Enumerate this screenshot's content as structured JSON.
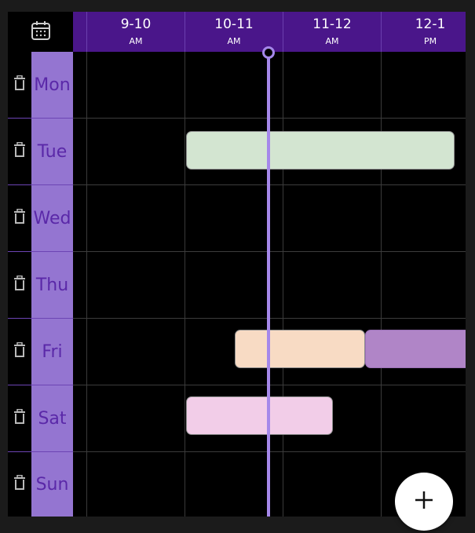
{
  "header": {
    "calendar_icon": "calendar-icon",
    "slots": [
      {
        "label": "9-10",
        "period": "AM"
      },
      {
        "label": "10-11",
        "period": "AM"
      },
      {
        "label": "11-12",
        "period": "AM"
      },
      {
        "label": "12-1",
        "period": "PM"
      }
    ]
  },
  "days": [
    {
      "name": "Mon",
      "delete_icon": "trash-icon"
    },
    {
      "name": "Tue",
      "delete_icon": "trash-icon"
    },
    {
      "name": "Wed",
      "delete_icon": "trash-icon"
    },
    {
      "name": "Thu",
      "delete_icon": "trash-icon"
    },
    {
      "name": "Fri",
      "delete_icon": "trash-icon"
    },
    {
      "name": "Sat",
      "delete_icon": "trash-icon"
    },
    {
      "name": "Sun",
      "delete_icon": "trash-icon"
    }
  ],
  "events": [
    {
      "day": "Tue",
      "color": "#d3e5d1"
    },
    {
      "day": "Fri",
      "color": "#f8dbc4"
    },
    {
      "day": "Fri",
      "color": "#b085c7"
    },
    {
      "day": "Sat",
      "color": "#f2cde8"
    }
  ],
  "fab": {
    "icon": "plus-icon"
  },
  "colors": {
    "header_bg": "#4a168a",
    "day_column_bg": "#9475d1",
    "day_text": "#5a28a8",
    "now_line": "#a588ea"
  }
}
